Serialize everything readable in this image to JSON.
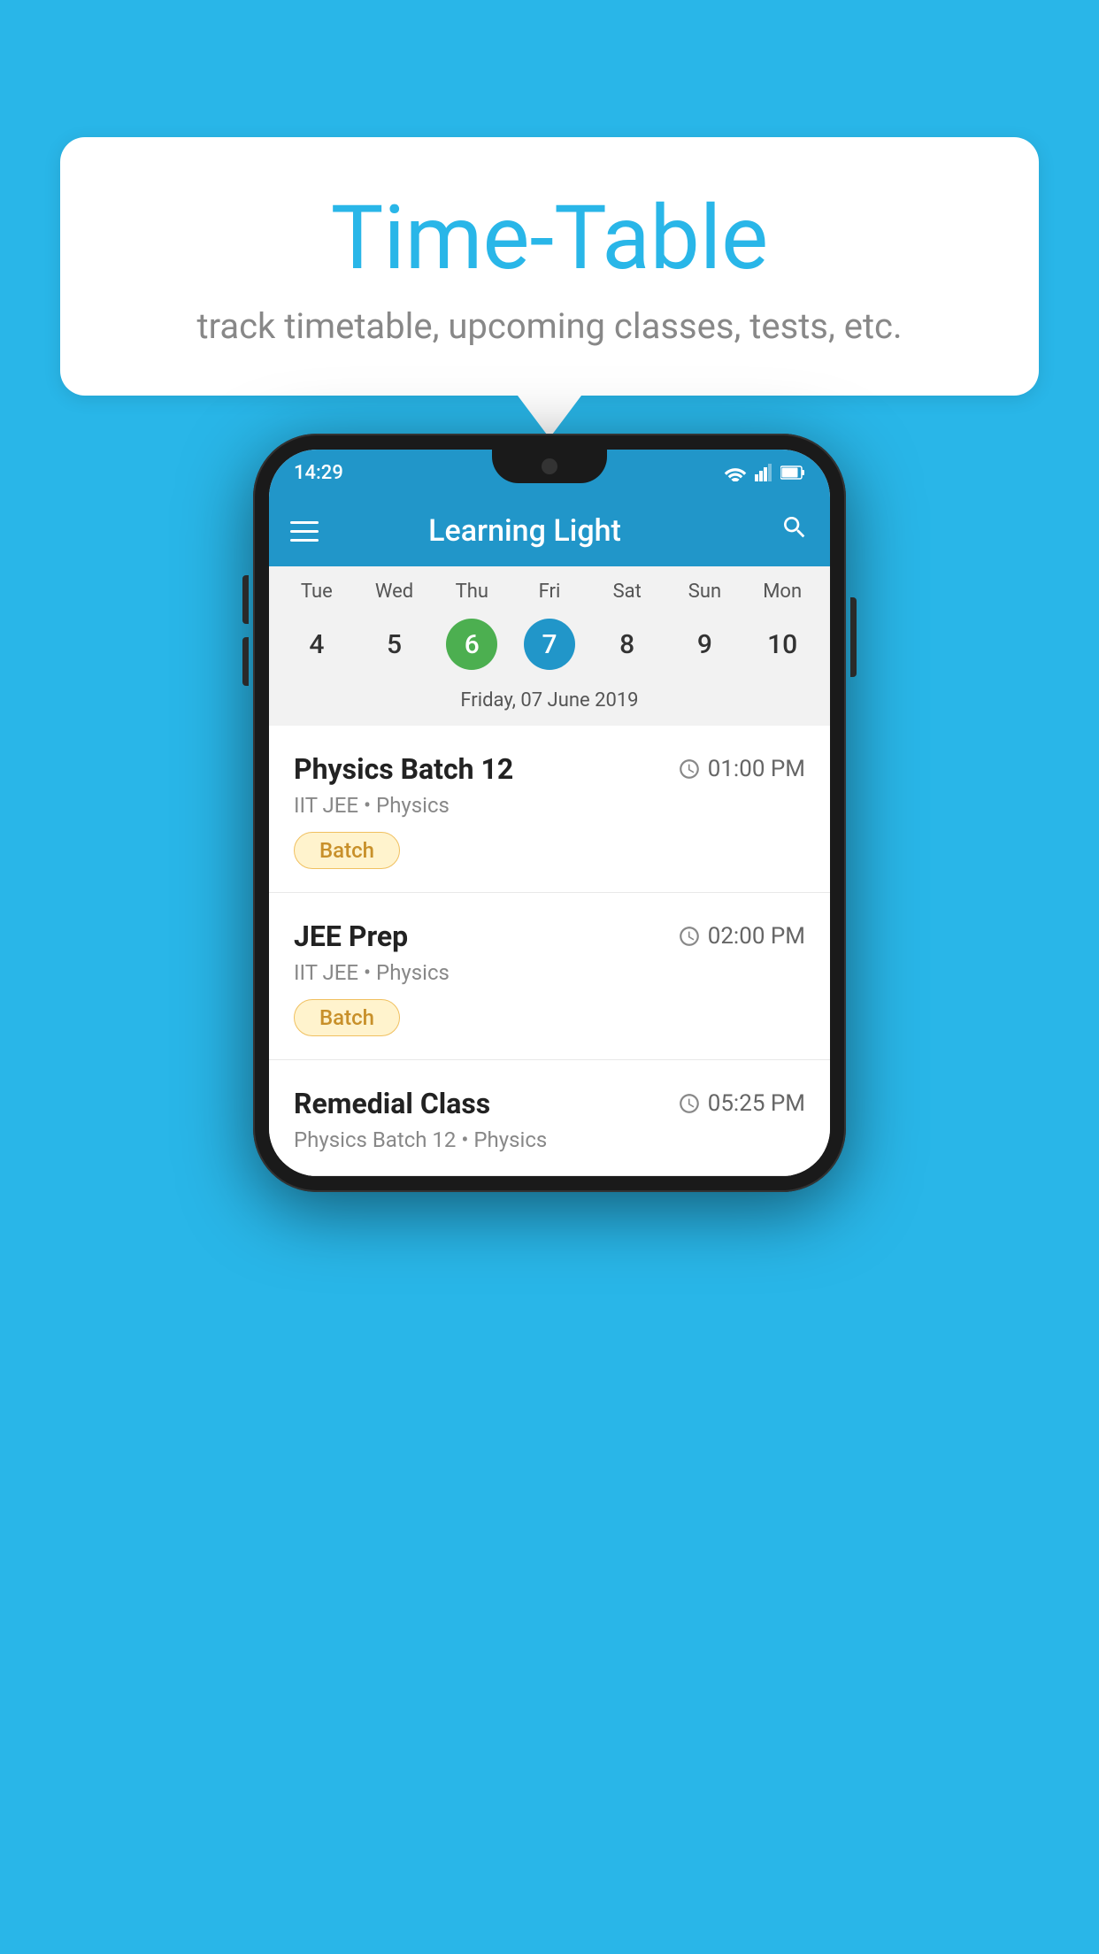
{
  "page": {
    "background_color": "#29B6E8"
  },
  "bubble": {
    "title": "Time-Table",
    "subtitle": "track timetable, upcoming classes, tests, etc."
  },
  "phone": {
    "status_bar": {
      "time": "14:29"
    },
    "app_bar": {
      "title": "Learning Light"
    },
    "calendar": {
      "days": [
        "Tue",
        "Wed",
        "Thu",
        "Fri",
        "Sat",
        "Sun",
        "Mon"
      ],
      "dates": [
        "4",
        "5",
        "6",
        "7",
        "8",
        "9",
        "10"
      ],
      "today_index": 2,
      "selected_index": 3,
      "selected_label": "Friday, 07 June 2019"
    },
    "schedule": [
      {
        "title": "Physics Batch 12",
        "time": "01:00 PM",
        "subtitle": "IIT JEE • Physics",
        "tag": "Batch"
      },
      {
        "title": "JEE Prep",
        "time": "02:00 PM",
        "subtitle": "IIT JEE • Physics",
        "tag": "Batch"
      },
      {
        "title": "Remedial Class",
        "time": "05:25 PM",
        "subtitle": "Physics Batch 12 • Physics",
        "tag": ""
      }
    ]
  }
}
